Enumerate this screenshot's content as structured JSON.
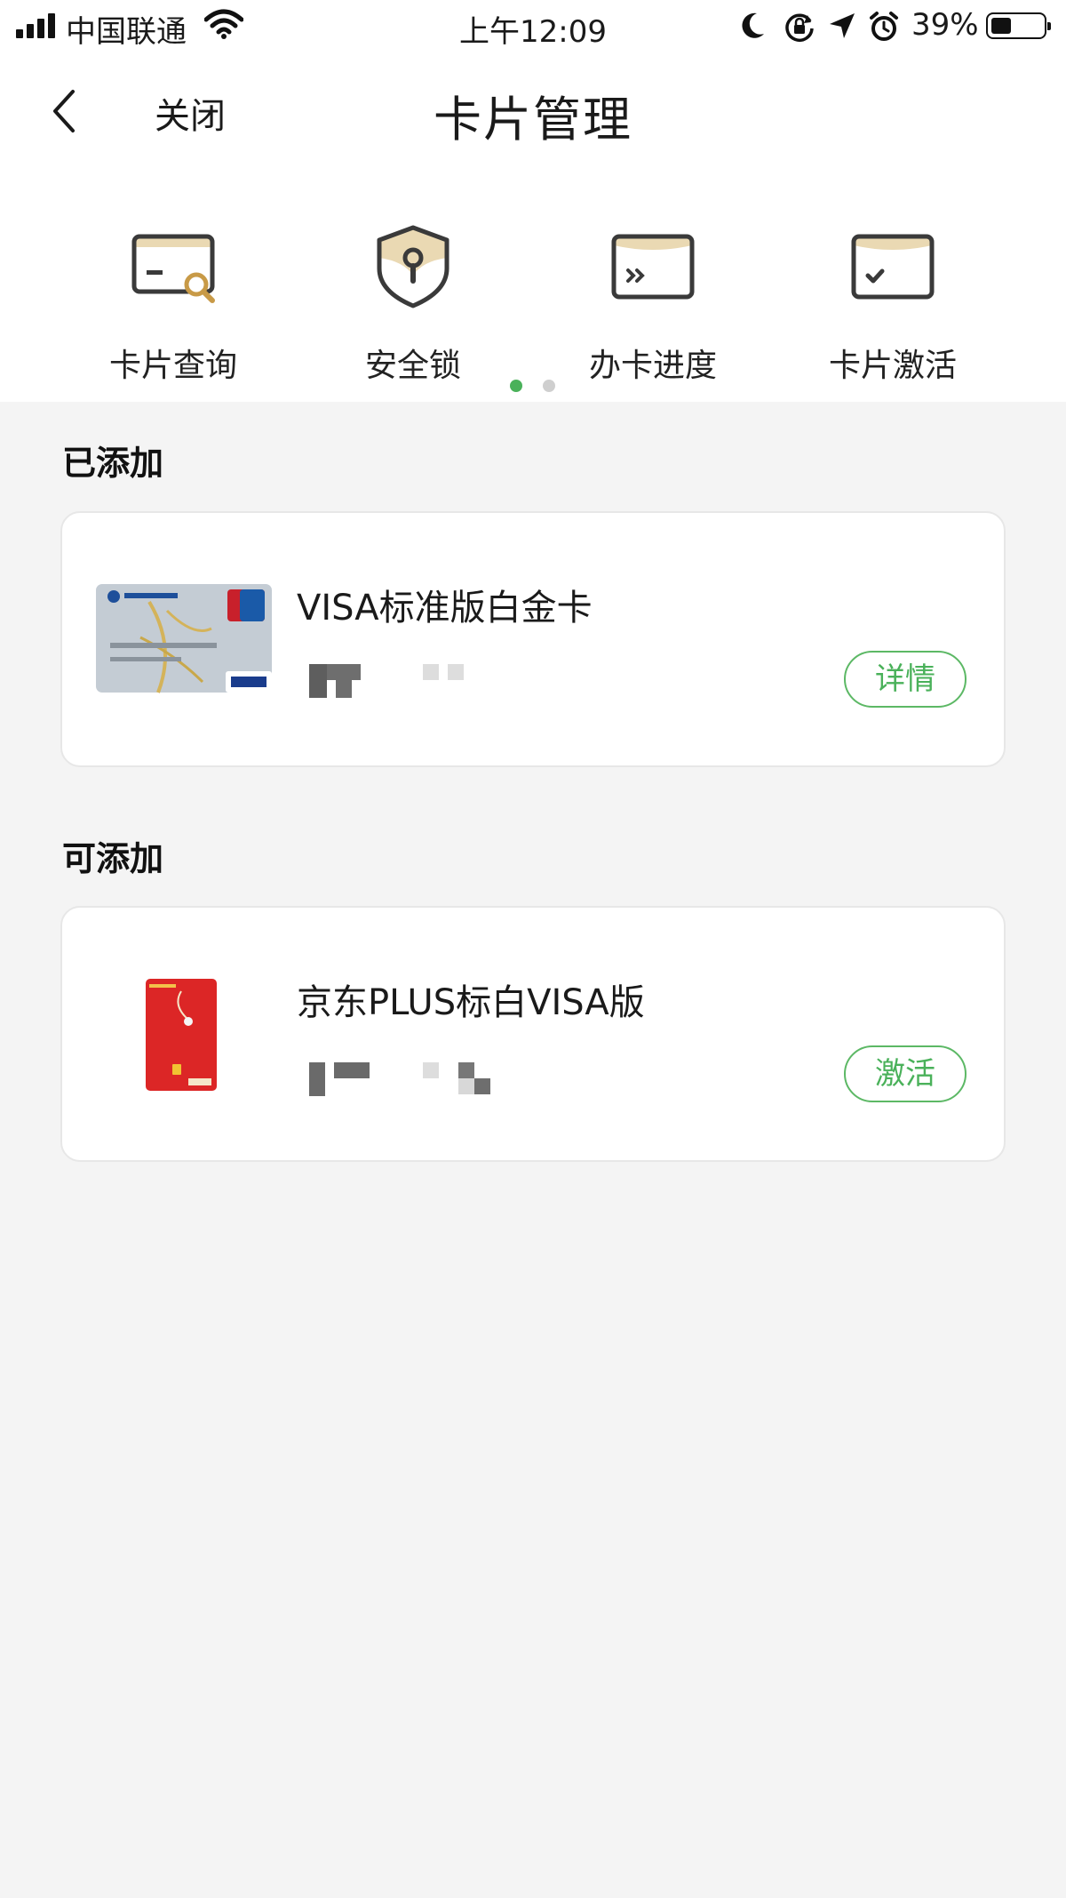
{
  "status_bar": {
    "carrier": "中国联通",
    "time": "上午12:09",
    "battery": "39%",
    "battery_level": 0.39,
    "icons": [
      "signal-icon",
      "wifi-icon",
      "moon-icon",
      "rotation-lock-icon",
      "location-icon",
      "alarm-icon",
      "battery-icon"
    ]
  },
  "nav": {
    "back_icon": "chevron-left-icon",
    "close_label": "关闭",
    "title": "卡片管理"
  },
  "actions": [
    {
      "label": "卡片查询",
      "icon": "card-search-icon"
    },
    {
      "label": "安全锁",
      "icon": "shield-lock-icon"
    },
    {
      "label": "办卡进度",
      "icon": "card-progress-icon"
    },
    {
      "label": "卡片激活",
      "icon": "card-activate-icon"
    }
  ],
  "pager": {
    "count": 2,
    "active": 0
  },
  "sections": {
    "added": {
      "title": "已添加",
      "card": {
        "name": "VISA标准版白金卡",
        "button": "详情"
      }
    },
    "available": {
      "title": "可添加",
      "card": {
        "name": "京东PLUS标白VISA版",
        "button": "激活"
      }
    }
  },
  "colors": {
    "accent_green": "#4ab15a",
    "background": "#f4f4f4",
    "icon_gold": "#ead9b3",
    "icon_stroke": "#3a3a3a"
  }
}
